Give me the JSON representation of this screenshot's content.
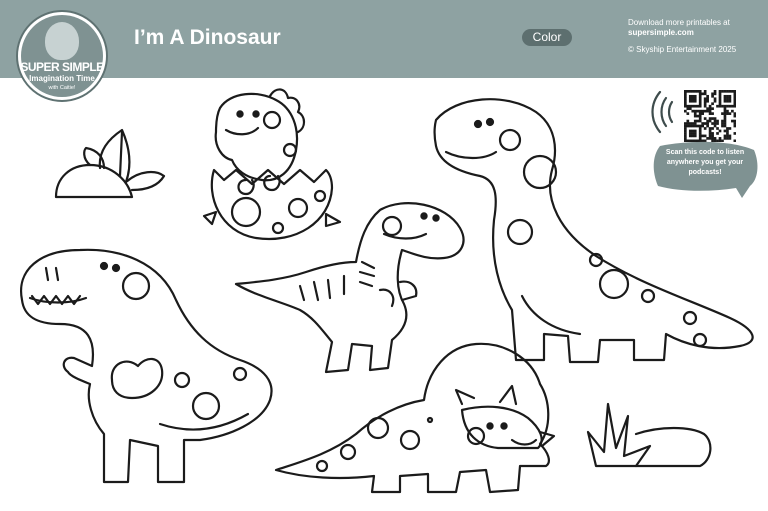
{
  "header": {
    "title": "I’m A Dinosaur",
    "mode_label": "Color",
    "download_text": "Download more printables at",
    "download_site": "supersimple.com",
    "copyright": "© Skyship Entertainment 2025",
    "background_color": "#8ea2a2"
  },
  "logo": {
    "brand": "SUPER SIMPLE",
    "show_name": "Imagination Time",
    "tagline": "with Caitie!"
  },
  "qr": {
    "caption": "Scan this code to listen anywhere you get your podcasts!",
    "icon": "sound-waves-icon"
  },
  "illustrations": [
    "baby-dinosaur-in-egg",
    "t-rex-large",
    "t-rex-small",
    "brontosaurus",
    "triceratops",
    "leafy-plant",
    "grass-tuft",
    "egg-shell-pieces"
  ]
}
